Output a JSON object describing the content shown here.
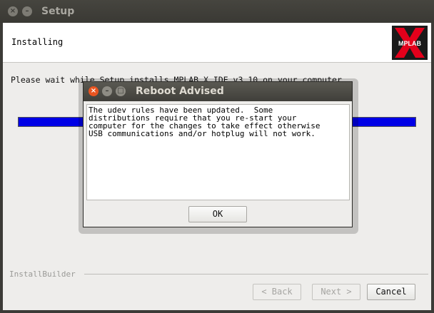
{
  "window": {
    "title": "Setup",
    "header_title": "Installing",
    "message": "Please wait while Setup installs MPLAB X IDE v3.10 on your computer.",
    "progress_fraction": 1.0,
    "brand_label": "InstallBuilder",
    "buttons": {
      "back": "< Back",
      "next": "Next >",
      "cancel": "Cancel"
    },
    "logo_text": "MPLAB"
  },
  "dialog": {
    "title": "Reboot Advised",
    "body": "The udev rules have been updated.  Some\ndistributions require that you re-start your\ncomputer for the changes to take effect otherwise\nUSB communications and/or hotplug will not work.",
    "ok": "OK"
  },
  "colors": {
    "progress": "#0000e6",
    "close_button": "#e95420",
    "logo_red": "#e3001b"
  }
}
